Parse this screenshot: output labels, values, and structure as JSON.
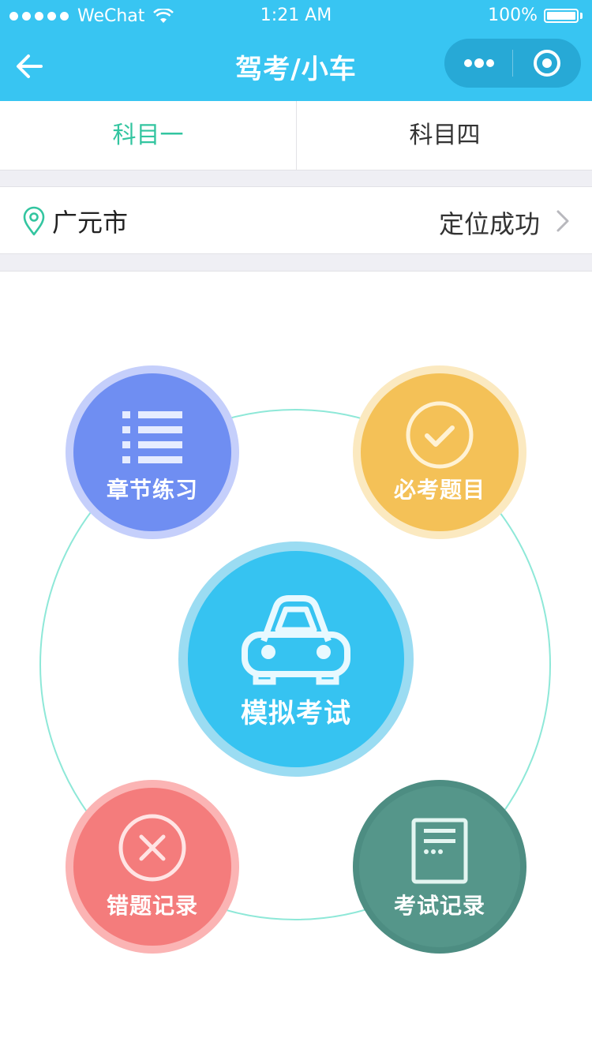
{
  "status_bar": {
    "carrier": "WeChat",
    "time": "1:21 AM",
    "battery": "100%"
  },
  "nav": {
    "title": "驾考/小车"
  },
  "tabs": [
    {
      "label": "科目一",
      "active": true
    },
    {
      "label": "科目四",
      "active": false
    }
  ],
  "location": {
    "city": "广元市",
    "status": "定位成功"
  },
  "menu": {
    "chapter": {
      "label": "章节练习",
      "icon": "list-icon",
      "color": "#6f8ef2"
    },
    "must": {
      "label": "必考题目",
      "icon": "check-circle-icon",
      "color": "#f4c157"
    },
    "exam": {
      "label": "模拟考试",
      "icon": "car-icon",
      "color": "#36c3f1"
    },
    "wrong": {
      "label": "错题记录",
      "icon": "x-circle-icon",
      "color": "#f47c7c"
    },
    "record": {
      "label": "考试记录",
      "icon": "document-icon",
      "color": "#55968a"
    }
  },
  "colors": {
    "header": "#38c5f2",
    "active_tab": "#33c5a0"
  }
}
